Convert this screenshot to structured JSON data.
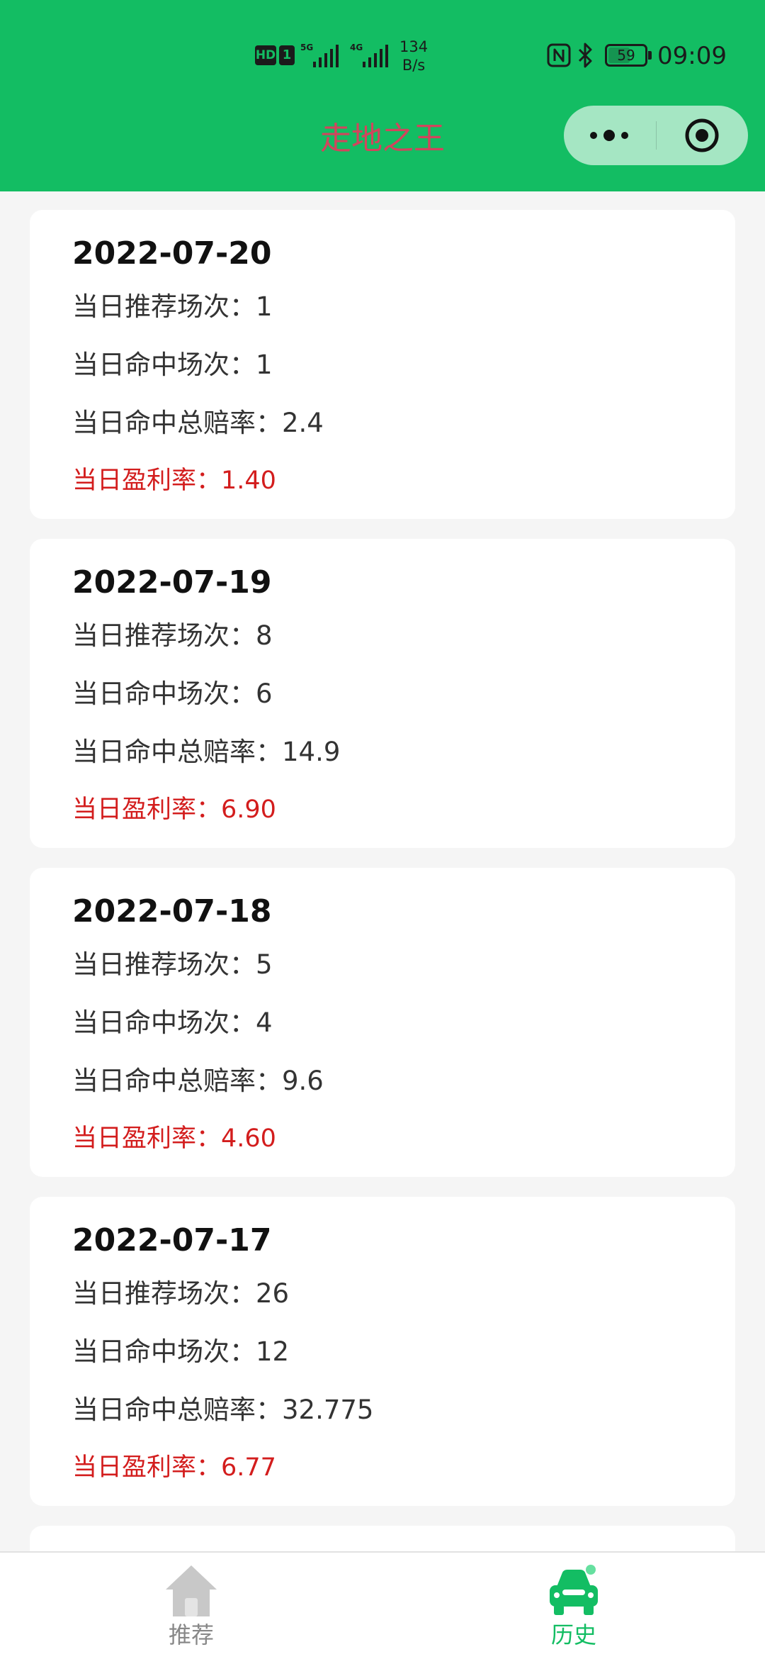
{
  "status_bar": {
    "hd_badge": "HD",
    "sim_badge": "1",
    "net1_label": "5G",
    "net2_label": "4G",
    "speed_value": "134",
    "speed_unit": "B/s",
    "battery_level": "59",
    "time": "09:09"
  },
  "nav": {
    "title": "走地之王"
  },
  "history": [
    {
      "date": "2022-07-20",
      "recommend_line": "当日推荐场次：1",
      "hit_line": "当日命中场次：1",
      "odds_line": "当日命中总赔率：2.4",
      "profit_line": "当日盈利率：1.40"
    },
    {
      "date": "2022-07-19",
      "recommend_line": "当日推荐场次：8",
      "hit_line": "当日命中场次：6",
      "odds_line": "当日命中总赔率：14.9",
      "profit_line": "当日盈利率：6.90"
    },
    {
      "date": "2022-07-18",
      "recommend_line": "当日推荐场次：5",
      "hit_line": "当日命中场次：4",
      "odds_line": "当日命中总赔率：9.6",
      "profit_line": "当日盈利率：4.60"
    },
    {
      "date": "2022-07-17",
      "recommend_line": "当日推荐场次：26",
      "hit_line": "当日命中场次：12",
      "odds_line": "当日命中总赔率：32.775",
      "profit_line": "当日盈利率：6.77"
    }
  ],
  "tabbar": {
    "tabs": [
      {
        "label": "推荐",
        "icon": "home-icon",
        "active": false
      },
      {
        "label": "历史",
        "icon": "car-icon",
        "active": true
      }
    ],
    "active_color": "#13bd63",
    "inactive_color": "#888888"
  },
  "colors": {
    "header_bg": "#13bd63",
    "title_color": "#d1455d",
    "profit_color": "#d31d1d",
    "page_bg": "#f5f5f5"
  }
}
